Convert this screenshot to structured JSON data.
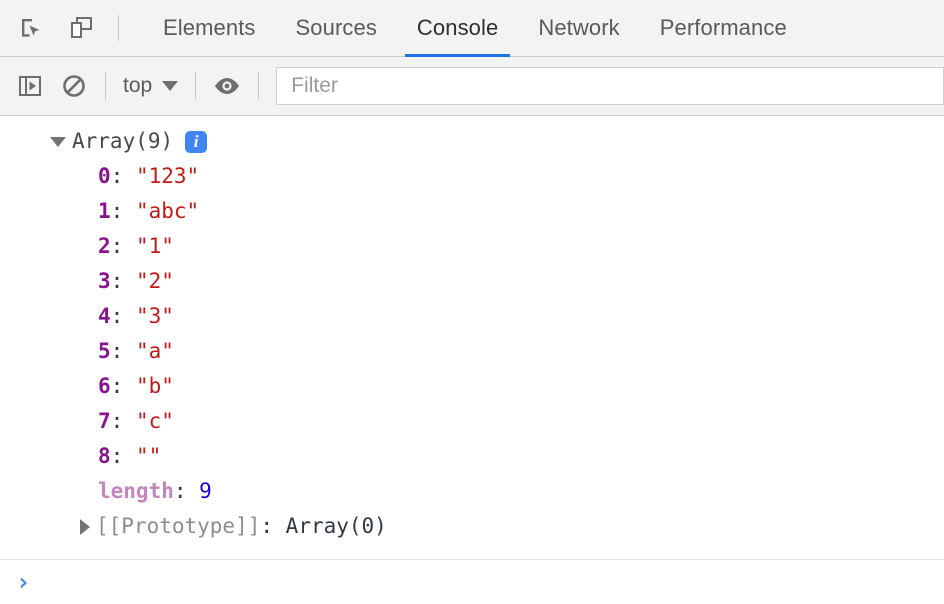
{
  "tabbar": {
    "inspect_icon": "inspect-element-icon",
    "device_icon": "device-toolbar-icon",
    "tabs": [
      {
        "label": "Elements",
        "active": false
      },
      {
        "label": "Sources",
        "active": false
      },
      {
        "label": "Console",
        "active": true
      },
      {
        "label": "Network",
        "active": false
      },
      {
        "label": "Performance",
        "active": false
      }
    ],
    "active_tab": "Console",
    "accent_color": "#1a73e8"
  },
  "toolbar": {
    "sidebar_toggle_icon": "console-sidebar-toggle-icon",
    "clear_console_icon": "clear-console-icon",
    "context_label": "top",
    "caret_icon": "chevron-down-icon",
    "live_expression_icon": "eye-icon",
    "filter": {
      "value": "",
      "placeholder": "Filter"
    }
  },
  "console": {
    "entry": {
      "expander_icon": "triangle-down-icon",
      "object_label": "Array(9)",
      "info_badge": "i",
      "info_badge_color": "#4285f4",
      "properties": [
        {
          "key": "0",
          "sep": ": ",
          "value": "\"123\"",
          "type": "string"
        },
        {
          "key": "1",
          "sep": ": ",
          "value": "\"abc\"",
          "type": "string"
        },
        {
          "key": "2",
          "sep": ": ",
          "value": "\"1\"",
          "type": "string"
        },
        {
          "key": "3",
          "sep": ": ",
          "value": "\"2\"",
          "type": "string"
        },
        {
          "key": "4",
          "sep": ": ",
          "value": "\"3\"",
          "type": "string"
        },
        {
          "key": "5",
          "sep": ": ",
          "value": "\"a\"",
          "type": "string"
        },
        {
          "key": "6",
          "sep": ": ",
          "value": "\"b\"",
          "type": "string"
        },
        {
          "key": "7",
          "sep": ": ",
          "value": "\"c\"",
          "type": "string"
        },
        {
          "key": "8",
          "sep": ": ",
          "value": "\"\"",
          "type": "string"
        },
        {
          "key": "length",
          "sep": ": ",
          "value": "9",
          "type": "number"
        }
      ],
      "prototype": {
        "expander_icon": "triangle-right-icon",
        "key": "[[Prototype]]",
        "sep": ": ",
        "value": "Array(0)"
      }
    }
  },
  "prompt": {
    "chevron": "›",
    "value": "",
    "placeholder": ""
  }
}
